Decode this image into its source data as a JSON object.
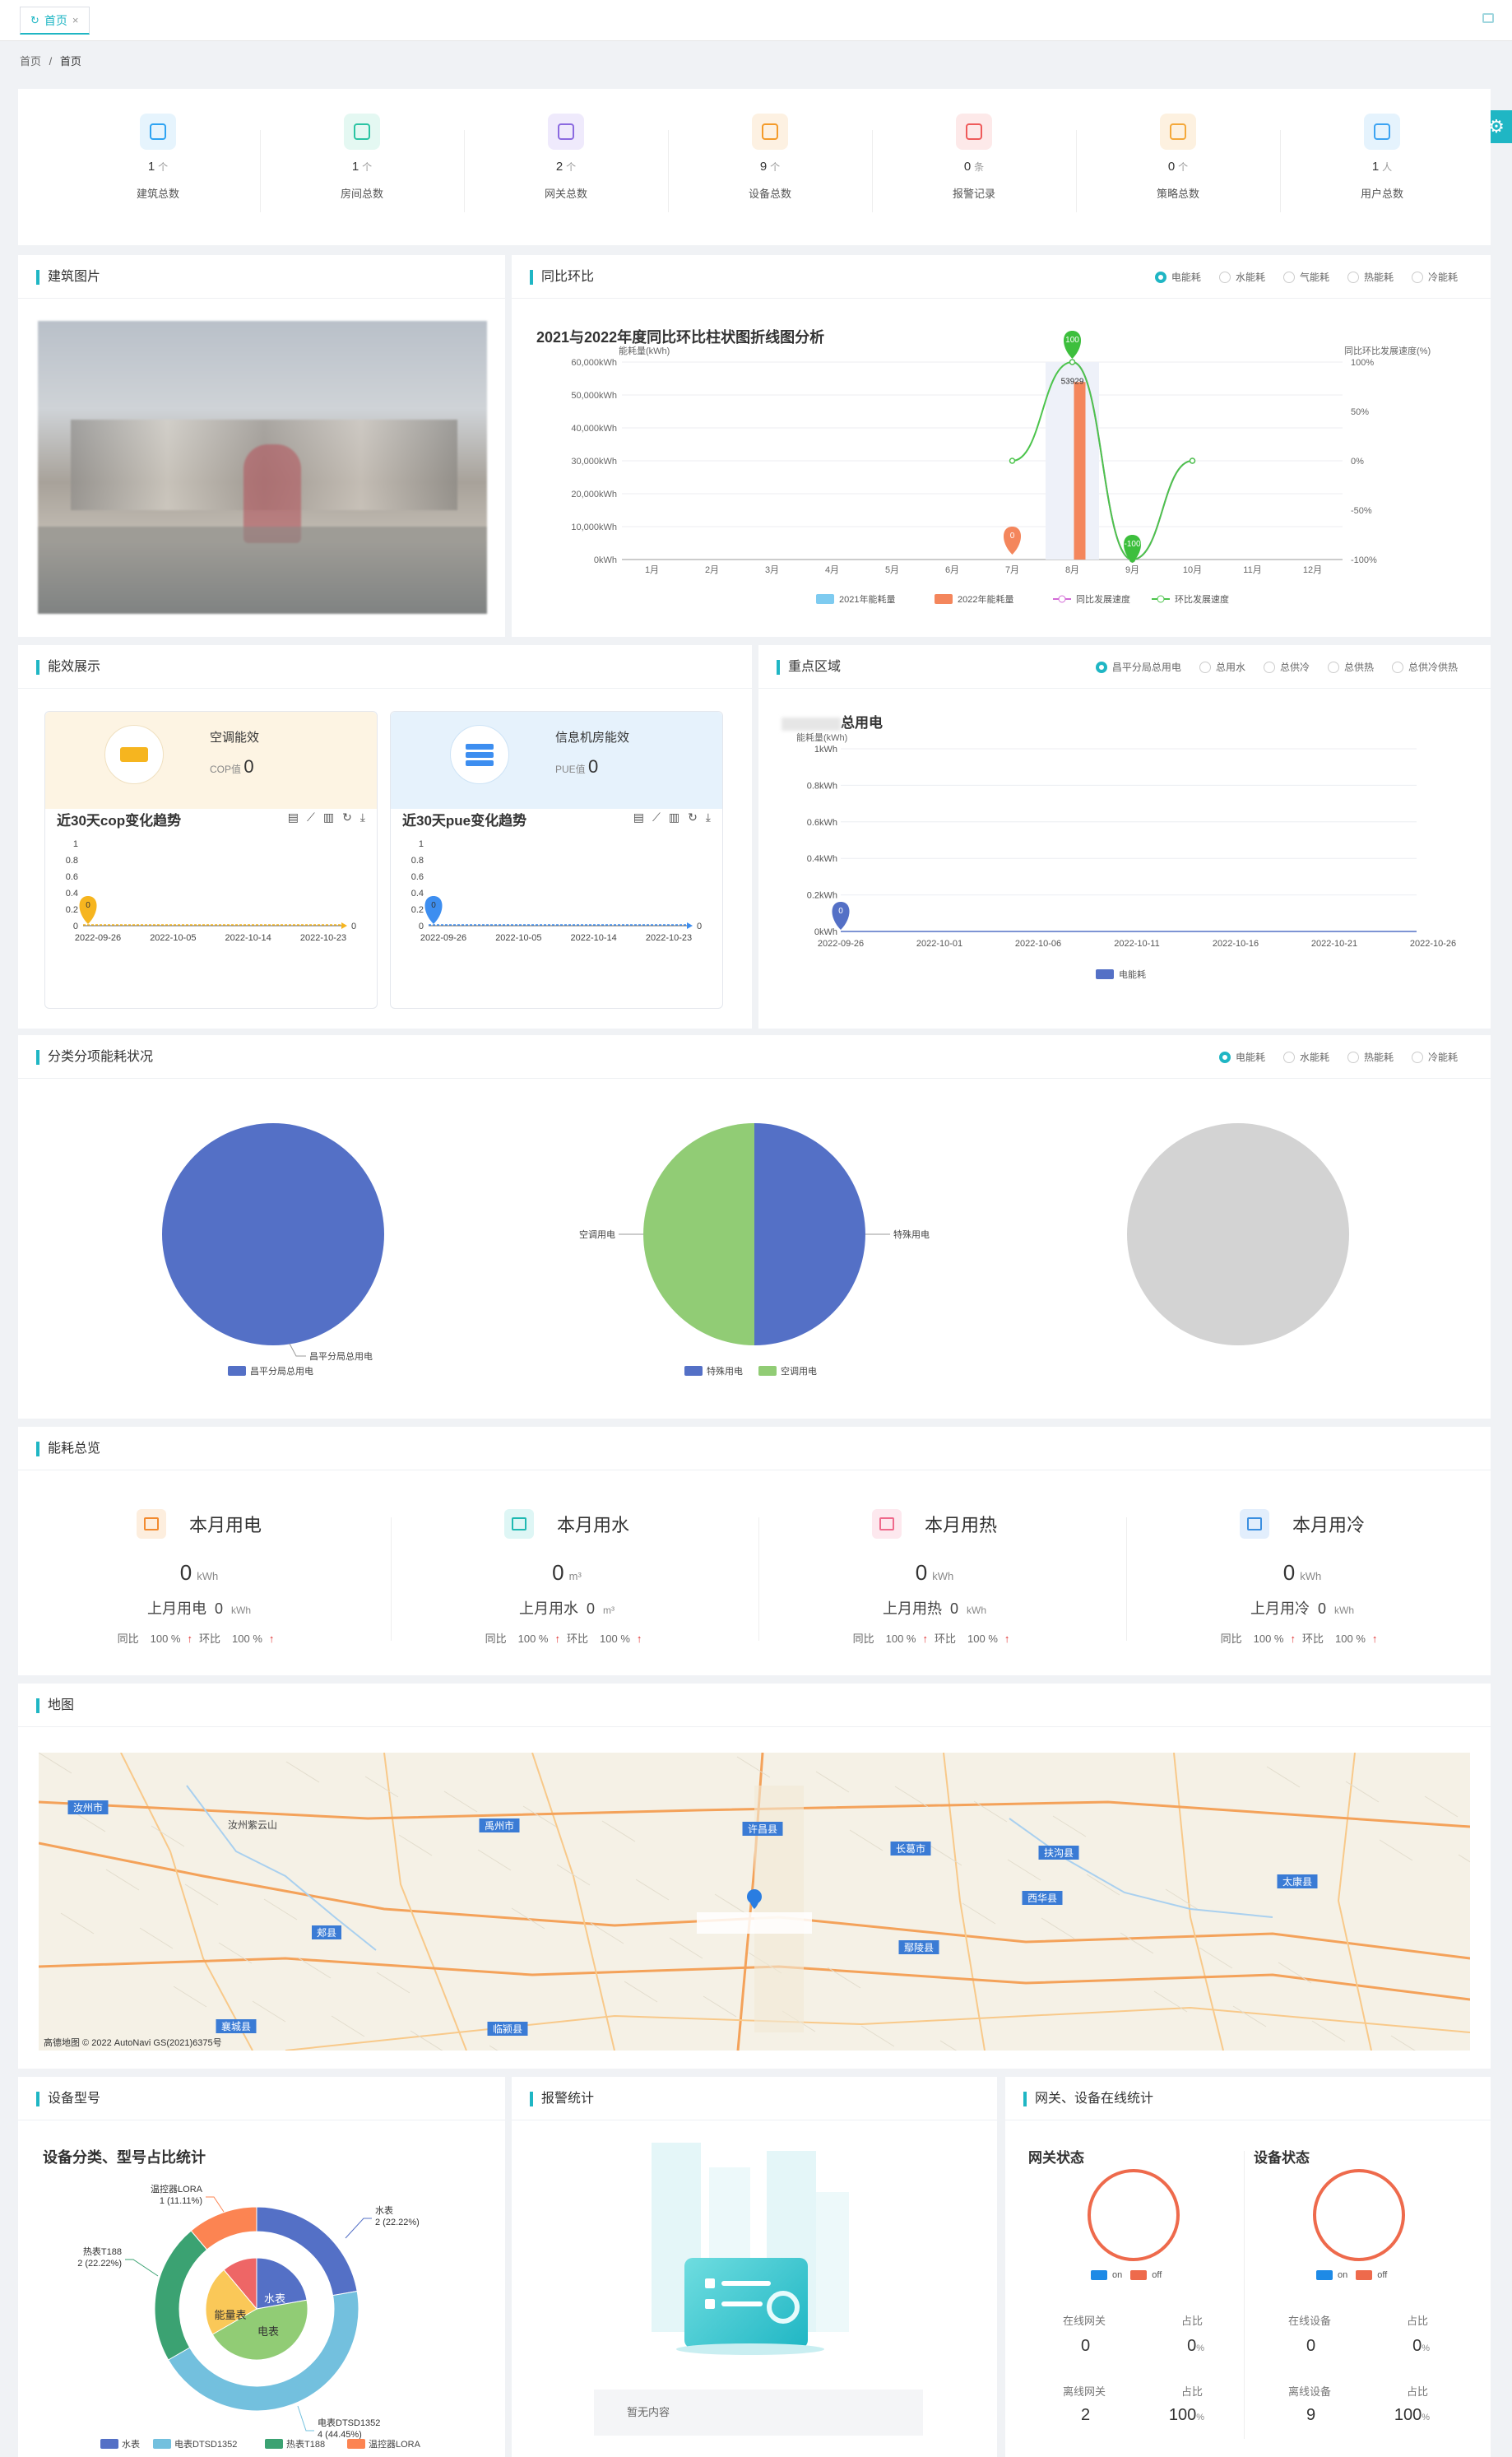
{
  "tab": {
    "home": "首页",
    "close": "×"
  },
  "breadcrumb": [
    "首页",
    "/",
    "首页"
  ],
  "stats": [
    {
      "value": "1",
      "unit": "个",
      "label": "建筑总数",
      "icon": "building-icon",
      "color": "#2ea3f2",
      "bg": "#e6f4fd"
    },
    {
      "value": "1",
      "unit": "个",
      "label": "房间总数",
      "icon": "house-icon",
      "color": "#2bc4a3",
      "bg": "#e4f8f2"
    },
    {
      "value": "2",
      "unit": "个",
      "label": "网关总数",
      "icon": "router-icon",
      "color": "#8b6ae0",
      "bg": "#efeafc"
    },
    {
      "value": "9",
      "unit": "个",
      "label": "设备总数",
      "icon": "layers-icon",
      "color": "#f49b2a",
      "bg": "#fdf1e2"
    },
    {
      "value": "0",
      "unit": "条",
      "label": "报警记录",
      "icon": "alarm-icon",
      "color": "#ef5a5a",
      "bg": "#fde9e9"
    },
    {
      "value": "0",
      "unit": "个",
      "label": "策略总数",
      "icon": "compass-icon",
      "color": "#f4a83a",
      "bg": "#fdf1e0"
    },
    {
      "value": "1",
      "unit": "人",
      "label": "用户总数",
      "icon": "users-icon",
      "color": "#3ca3f2",
      "bg": "#e5f3fd"
    }
  ],
  "building": {
    "title": "建筑图片"
  },
  "yoy": {
    "title": "同比环比",
    "radios": [
      "电能耗",
      "水能耗",
      "气能耗",
      "热能耗",
      "冷能耗"
    ],
    "selected": 0
  },
  "efficiency": {
    "title": "能效展示",
    "cards": [
      {
        "name": "空调能效",
        "metric": "COP值",
        "value": "0",
        "trend_title": "近30天cop变化趋势"
      },
      {
        "name": "信息机房能效",
        "metric": "PUE值",
        "value": "0",
        "trend_title": "近30天pue变化趋势"
      }
    ]
  },
  "keyarea": {
    "title": "重点区域",
    "radios": [
      "昌平分局总用电",
      "总用水",
      "总供冷",
      "总供热",
      "总供冷供热"
    ],
    "selected": 0,
    "chart_title": "总用电"
  },
  "category": {
    "title": "分类分项能耗状况",
    "radios": [
      "电能耗",
      "水能耗",
      "热能耗",
      "冷能耗"
    ],
    "selected": 0
  },
  "overview": {
    "title": "能耗总览",
    "items": [
      {
        "name": "本月用电",
        "value": "0",
        "unit": "kWh",
        "last_label": "上月用电",
        "last_value": "0",
        "last_unit": "kWh",
        "yoy": "同比",
        "yoy_val": "100 %",
        "mom": "环比",
        "mom_val": "100 %",
        "icon": "electricity-meter-icon",
        "color": "#f28b30",
        "bg": "#fdeede"
      },
      {
        "name": "本月用水",
        "value": "0",
        "unit": "m³",
        "last_label": "上月用水",
        "last_value": "0",
        "last_unit": "m³",
        "yoy": "同比",
        "yoy_val": "100 %",
        "mom": "环比",
        "mom_val": "100 %",
        "icon": "water-meter-icon",
        "color": "#20b9b2",
        "bg": "#def6f5"
      },
      {
        "name": "本月用热",
        "value": "0",
        "unit": "kWh",
        "last_label": "上月用热",
        "last_value": "0",
        "last_unit": "kWh",
        "yoy": "同比",
        "yoy_val": "100 %",
        "mom": "环比",
        "mom_val": "100 %",
        "icon": "heat-meter-icon",
        "color": "#ef6a8c",
        "bg": "#fde8ee"
      },
      {
        "name": "本月用冷",
        "value": "0",
        "unit": "kWh",
        "last_label": "上月用冷",
        "last_value": "0",
        "last_unit": "kWh",
        "yoy": "同比",
        "yoy_val": "100 %",
        "mom": "环比",
        "mom_val": "100 %",
        "icon": "cold-meter-icon",
        "color": "#3b8fe0",
        "bg": "#e2eefc"
      }
    ]
  },
  "map": {
    "title": "地图",
    "labels": [
      "汝州市",
      "禹州市",
      "长葛市",
      "许昌县",
      "鄢陵县",
      "扶沟县",
      "太康县",
      "郏县",
      "襄城县",
      "临颍县",
      "西华县",
      "汝州紫云山"
    ],
    "credit": "高德地图 © 2022 AutoNavi GS(2021)6375号"
  },
  "device": {
    "title": "设备型号",
    "chart_title": "设备分类、型号占比统计"
  },
  "alarm": {
    "title": "报警统计",
    "empty": "暂无内容"
  },
  "online": {
    "title": "网关、设备在线统计",
    "gateway": {
      "title": "网关状态",
      "on": "on",
      "off": "off",
      "online_label": "在线网关",
      "online_value": "0",
      "ratio_label": "占比",
      "ratio1": "0",
      "offline_label": "离线网关",
      "offline_value": "2",
      "ratio2": "100",
      "pct": "%"
    },
    "devices": {
      "title": "设备状态",
      "on": "on",
      "off": "off",
      "online_label": "在线设备",
      "online_value": "0",
      "ratio_label": "占比",
      "ratio1": "0",
      "offline_label": "离线设备",
      "offline_value": "9",
      "ratio2": "100",
      "pct": "%"
    }
  },
  "chart_data": [
    {
      "type": "bar",
      "title": "2021与2022年度同比环比柱状图折线图分析",
      "ylabel": "能耗量(kWh)",
      "y2label": "同比环比发展速度(%)",
      "categories": [
        "1月",
        "2月",
        "3月",
        "4月",
        "5月",
        "6月",
        "7月",
        "8月",
        "9月",
        "10月",
        "11月",
        "12月"
      ],
      "ylim": [
        0,
        60000
      ],
      "y2lim": [
        -100,
        100
      ],
      "yticks": [
        "0kWh",
        "10,000kWh",
        "20,000kWh",
        "30,000kWh",
        "40,000kWh",
        "50,000kWh",
        "60,000kWh"
      ],
      "y2ticks": [
        "-100%",
        "-50%",
        "0%",
        "50%",
        "100%"
      ],
      "series": [
        {
          "name": "2021年能耗量",
          "kind": "bar",
          "color": "#7ecbf0",
          "values": [
            0,
            0,
            0,
            0,
            0,
            0,
            0,
            0,
            0,
            0,
            0,
            0
          ]
        },
        {
          "name": "2022年能耗量",
          "kind": "bar",
          "color": "#f4865c",
          "values": [
            0,
            0,
            0,
            0,
            0,
            0,
            0,
            53929,
            0,
            0,
            0,
            0
          ]
        },
        {
          "name": "同比发展速度",
          "kind": "line",
          "color": "#d36ad6",
          "values": [
            null,
            null,
            null,
            null,
            null,
            null,
            null,
            100,
            -100,
            0,
            null,
            null
          ]
        },
        {
          "name": "环比发展速度",
          "kind": "line",
          "color": "#4cc44c",
          "values": [
            null,
            null,
            null,
            null,
            null,
            null,
            0,
            100,
            -100,
            0,
            null,
            null
          ]
        }
      ],
      "markers": [
        {
          "label": "0",
          "month": "7月",
          "color": "#f4865c"
        },
        {
          "label": "100",
          "month": "8月",
          "color": "#3dbf3d"
        },
        {
          "label": "53929",
          "month": "8月",
          "color": "#f4865c"
        },
        {
          "label": "-100",
          "month": "9月",
          "color": "#3dbf3d"
        }
      ]
    },
    {
      "type": "line",
      "title": "近30天cop变化趋势",
      "x": [
        "2022-09-26",
        "2022-10-05",
        "2022-10-14",
        "2022-10-23"
      ],
      "values": [
        0,
        0,
        0,
        0
      ],
      "yticks": [
        "0",
        "0.2",
        "0.4",
        "0.6",
        "0.8",
        "1"
      ],
      "marker": "0",
      "end_label": "0",
      "color": "#f6b51f"
    },
    {
      "type": "line",
      "title": "近30天pue变化趋势",
      "x": [
        "2022-09-26",
        "2022-10-05",
        "2022-10-14",
        "2022-10-23"
      ],
      "values": [
        0,
        0,
        0,
        0
      ],
      "yticks": [
        "0",
        "0.2",
        "0.4",
        "0.6",
        "0.8",
        "1"
      ],
      "marker": "0",
      "end_label": "0",
      "color": "#3d8ef0"
    },
    {
      "type": "line",
      "ylabel": "能耗量(kWh)",
      "x": [
        "2022-09-26",
        "2022-10-01",
        "2022-10-06",
        "2022-10-11",
        "2022-10-16",
        "2022-10-21",
        "2022-10-26"
      ],
      "yticks": [
        "0kWh",
        "0.2kWh",
        "0.4kWh",
        "0.6kWh",
        "0.8kWh",
        "1kWh"
      ],
      "series": [
        {
          "name": "电能耗",
          "values": [
            0,
            0,
            0,
            0,
            0,
            0,
            0
          ],
          "color": "#5470c6"
        }
      ],
      "marker": "0"
    },
    {
      "type": "pie",
      "series": [
        {
          "name": "昌平分局总用电",
          "value": 1,
          "color": "#5470c6"
        }
      ],
      "labels": [
        "昌平分局总用电"
      ]
    },
    {
      "type": "pie",
      "series": [
        {
          "name": "特殊用电",
          "value": 1,
          "color": "#5470c6"
        },
        {
          "name": "空调用电",
          "value": 1,
          "color": "#91cc75"
        }
      ],
      "labels": [
        "特殊用电",
        "空调用电"
      ]
    },
    {
      "type": "pie",
      "series": [
        {
          "name": "",
          "value": 1,
          "color": "#d3d3d3"
        }
      ]
    },
    {
      "type": "pie",
      "inner": [
        {
          "name": "水表",
          "value": 2,
          "color": "#5470c6"
        },
        {
          "name": "电表",
          "value": 4,
          "color": "#91cc75"
        },
        {
          "name": "能量表",
          "value": 2,
          "color": "#fac858"
        },
        {
          "name": "",
          "value": 1,
          "color": "#ee6666"
        }
      ],
      "outer": [
        {
          "name": "水表",
          "value": 2,
          "pct": "22.22%",
          "color": "#5470c6"
        },
        {
          "name": "电表DTSD1352",
          "value": 4,
          "pct": "44.45%",
          "color": "#73c0de"
        },
        {
          "name": "热表T188",
          "value": 2,
          "pct": "22.22%",
          "color": "#3ba272"
        },
        {
          "name": "温控器LORA",
          "value": 1,
          "pct": "11.11%",
          "color": "#fc8452"
        }
      ],
      "callouts": [
        {
          "text": "水表",
          "sub": "2 (22.22%)"
        },
        {
          "text": "电表DTSD1352",
          "sub": "4 (44.45%)"
        },
        {
          "text": "热表T188",
          "sub": "2 (22.22%)"
        },
        {
          "text": "温控器LORA",
          "sub": "1 (11.11%)"
        }
      ]
    }
  ]
}
